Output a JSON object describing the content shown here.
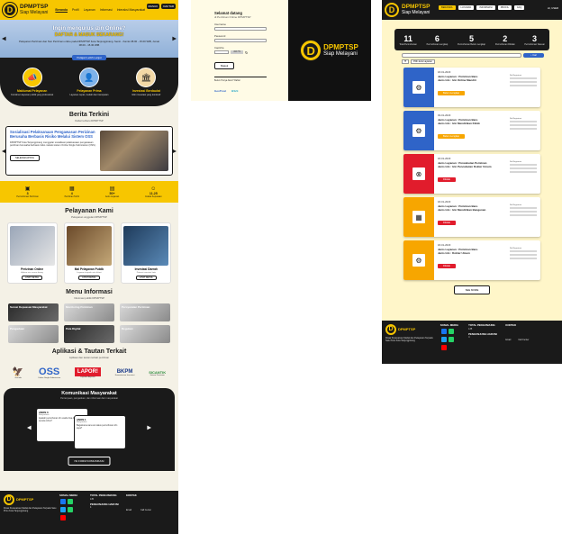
{
  "brand": {
    "name": "DPMPTSP",
    "tagline": "Siap Melayani",
    "logo_letter": "D"
  },
  "colors": {
    "yellow": "#f7c600",
    "dark": "#1a1a1a",
    "blue": "#2f64c8",
    "orange": "#f7a600",
    "red": "#e11c2c"
  },
  "home": {
    "nav": {
      "items": [
        "Beranda",
        "Profil",
        "Layanan",
        "Informasi",
        "Interaksi Masyarakat"
      ],
      "active": "Beranda",
      "login": "MASUK",
      "register": "DAFTAR"
    },
    "hero": {
      "title": "Ingin mengurus izin Online?",
      "highlight": "DAFTAR & MASUK SEKARANG!",
      "desc": "Pelayanan Perizinan dan Non Perizinan online pada DPMPTSP Kota Tanjungpinang. Senin - Kamis 08.00 - 15.00 WIB, Jumat 08.00 - 15.30 WIB",
      "button": "Pelajari Lebih Lanjut"
    },
    "features": [
      {
        "icon": "megaphone-icon",
        "glyph": "📣",
        "label": "Maklumat Pelayanan",
        "desc": "Komitmen layanan publik yang profesional"
      },
      {
        "icon": "person-icon",
        "glyph": "👤",
        "label": "Pelayanan Prima",
        "desc": "Layanan cepat, mudah dan transparan"
      },
      {
        "icon": "presentation-icon",
        "glyph": "🏛",
        "label": "Investasi Berdaulat",
        "desc": "Iklim investasi yang kondusif"
      }
    ],
    "news": {
      "title": "Berita Terkini",
      "subtitle": "Kabar terbaru DPMPTSP",
      "headline": "Sosialisasi Pelaksanaan Pengawasan Perizinan Berusaha Berbasis Risiko Melalui Sistem OSS",
      "body": "DPMPTSP Kota Tanjungpinang menggelar sosialisasi pelaksanaan pengawasan perizinan berusaha berbasis risiko melalui sistem Online Single Submission (OSS).",
      "button": "SELENGKAPNYA"
    },
    "stats": [
      {
        "icon": "certificate-icon",
        "value": "3",
        "label": "Permohonan Perizinan"
      },
      {
        "icon": "calendar-icon",
        "value": "4",
        "label": "Perizinan Terbit"
      },
      {
        "icon": "document-icon",
        "value": "50+",
        "label": "Jenis Layanan"
      },
      {
        "icon": "people-icon",
        "value": "11.25",
        "label": "Indeks Kepuasan"
      }
    ],
    "services": {
      "title": "Pelayanan Kami",
      "subtitle": "Pelayanan unggulan DPMPTSP",
      "items": [
        {
          "title": "Perizinan Online",
          "desc": "Ajukan izin secara daring",
          "button": "LIHAT DETAIL"
        },
        {
          "title": "Mal Pelayanan Publik",
          "desc": "Layanan terpadu satu lokasi",
          "button": "LIHAT DETAIL"
        },
        {
          "title": "Investasi Daerah",
          "desc": "Potensi investasi kota",
          "button": "LIHAT DETAIL"
        }
      ]
    },
    "menu_info": {
      "title": "Menu Informasi",
      "subtitle": "Informasi publik DPMPTSP",
      "tiles": [
        "Survei Kepuasan Masyarakat",
        "Monitoring Perizinan",
        "Persyaratan Perizinan",
        "Pengaduan",
        "Peta Digital",
        "Regulasi"
      ]
    },
    "apps": {
      "title": "Aplikasi & Tautan Terkait",
      "subtitle": "Aplikasi dan tautan terkait perizinan",
      "items": [
        {
          "mark": "🦅",
          "caption": "Garuda"
        },
        {
          "mark": "OSS",
          "caption": "Online Single Submission"
        },
        {
          "mark": "LAPOR!",
          "caption": "Layanan Aspirasi"
        },
        {
          "mark": "BKPM",
          "caption": "Kementerian Investasi"
        },
        {
          "mark": "SICANTIK",
          "caption": "Sistem Perizinan"
        }
      ]
    },
    "community": {
      "title": "Komunikasi Masyarakat",
      "subtitle": "Pertanyaan, pengaduan, dan informasi dari masyarakat",
      "cards": [
        {
          "name": "ANON 3",
          "role": "Masyarakat",
          "message": "Apakah permohonan izin usaha bisa dilakukan secara online?"
        },
        {
          "name": "ANON 1",
          "role": "Masyarakat",
          "message": "Bagaimana cara cek status permohonan izin saya?"
        }
      ],
      "button": "ISI FORM KOMUNIKASI"
    },
    "footer": {
      "about": "Dinas Penanaman Modal dan Pelayanan Terpadu Satu Pintu Kota Tanjungpinang",
      "social_title": "SOSIAL MEDIA",
      "visitor_title": "TOTAL PENGUNJUNG",
      "visitor_value": "135",
      "today_title": "PENGUNJUNG HARI INI",
      "today_value": "4",
      "contact_title": "KONTAK",
      "email_label": "Email",
      "call_label": "Call Center"
    }
  },
  "login": {
    "title": "Selamat datang",
    "subtitle": "di Perizinan Online DPMPTSP",
    "username_label": "Username",
    "password_label": "Password",
    "captcha_label": "Captcha",
    "captcha_code": "3 8 7 5",
    "button": "Masuk",
    "links": "Belum Punya Akun? Daftar",
    "seal1": "GeoTrust",
    "seal2": "BSrE"
  },
  "tracking": {
    "nav": {
      "items": [
        "BERANDA",
        "LAYANAN",
        "INFORMASI",
        "PROFIL",
        "FAQ"
      ],
      "active": "BERANDA",
      "user": "HI, USER"
    },
    "stats": [
      {
        "value": "11",
        "label": "Total Permohonan"
      },
      {
        "value": "6",
        "label": "Permohonan Lengkap"
      },
      {
        "value": "5",
        "label": "Permohonan Belum Lengkap"
      },
      {
        "value": "2",
        "label": "Permohonan Ditolak"
      },
      {
        "value": "3",
        "label": "Permohonan Selesai"
      }
    ],
    "search_button": "Cari",
    "filter": "Pilih Jenis Layanan",
    "cards": [
      {
        "date": "18-01-2023",
        "service": "Jenis Layanan : Perizinan Baru",
        "detail": "Jenis Izin : Izin Online Mandiri",
        "status": "Belum Lengkap",
        "status_color": "#f7a600",
        "thumb_color": "#2f64c8",
        "icon": "stamp-icon",
        "glyph": "⚙"
      },
      {
        "date": "03-01-2023",
        "service": "Jenis Layanan : Perizinan Baru",
        "detail": "Jenis Izin : Izin Mendirikan Klinik",
        "status": "Belum Lengkap",
        "status_color": "#f7a600",
        "thumb_color": "#2f64c8",
        "icon": "stamp-icon",
        "glyph": "⚙"
      },
      {
        "date": "18-01-2023",
        "service": "Jenis Layanan : Pencabutan Perizinan",
        "detail": "Jenis Izin : Izin Pencabutan Dokter Umum",
        "status": "Ditolak",
        "status_color": "#e11c2c",
        "thumb_color": "#e11c2c",
        "icon": "revoke-icon",
        "glyph": "⊗"
      },
      {
        "date": "18-01-2023",
        "service": "Jenis Layanan : Perizinan Baru",
        "detail": "Jenis Izin : Izin Mendirikan Bangunan",
        "status": "Ditolak",
        "status_color": "#e11c2c",
        "thumb_color": "#f7a600",
        "icon": "building-icon",
        "glyph": "▦"
      },
      {
        "date": "18-01-2023",
        "service": "Jenis Layanan : Perizinan Baru",
        "detail": "Jenis Izin : Dokter Umum",
        "status": "Ditolak",
        "status_color": "#e11c2c",
        "thumb_color": "#f7a600",
        "icon": "stamp-icon",
        "glyph": "⚙"
      }
    ],
    "meta_label": "No Registrasi",
    "more_button": "SEE MORE"
  }
}
